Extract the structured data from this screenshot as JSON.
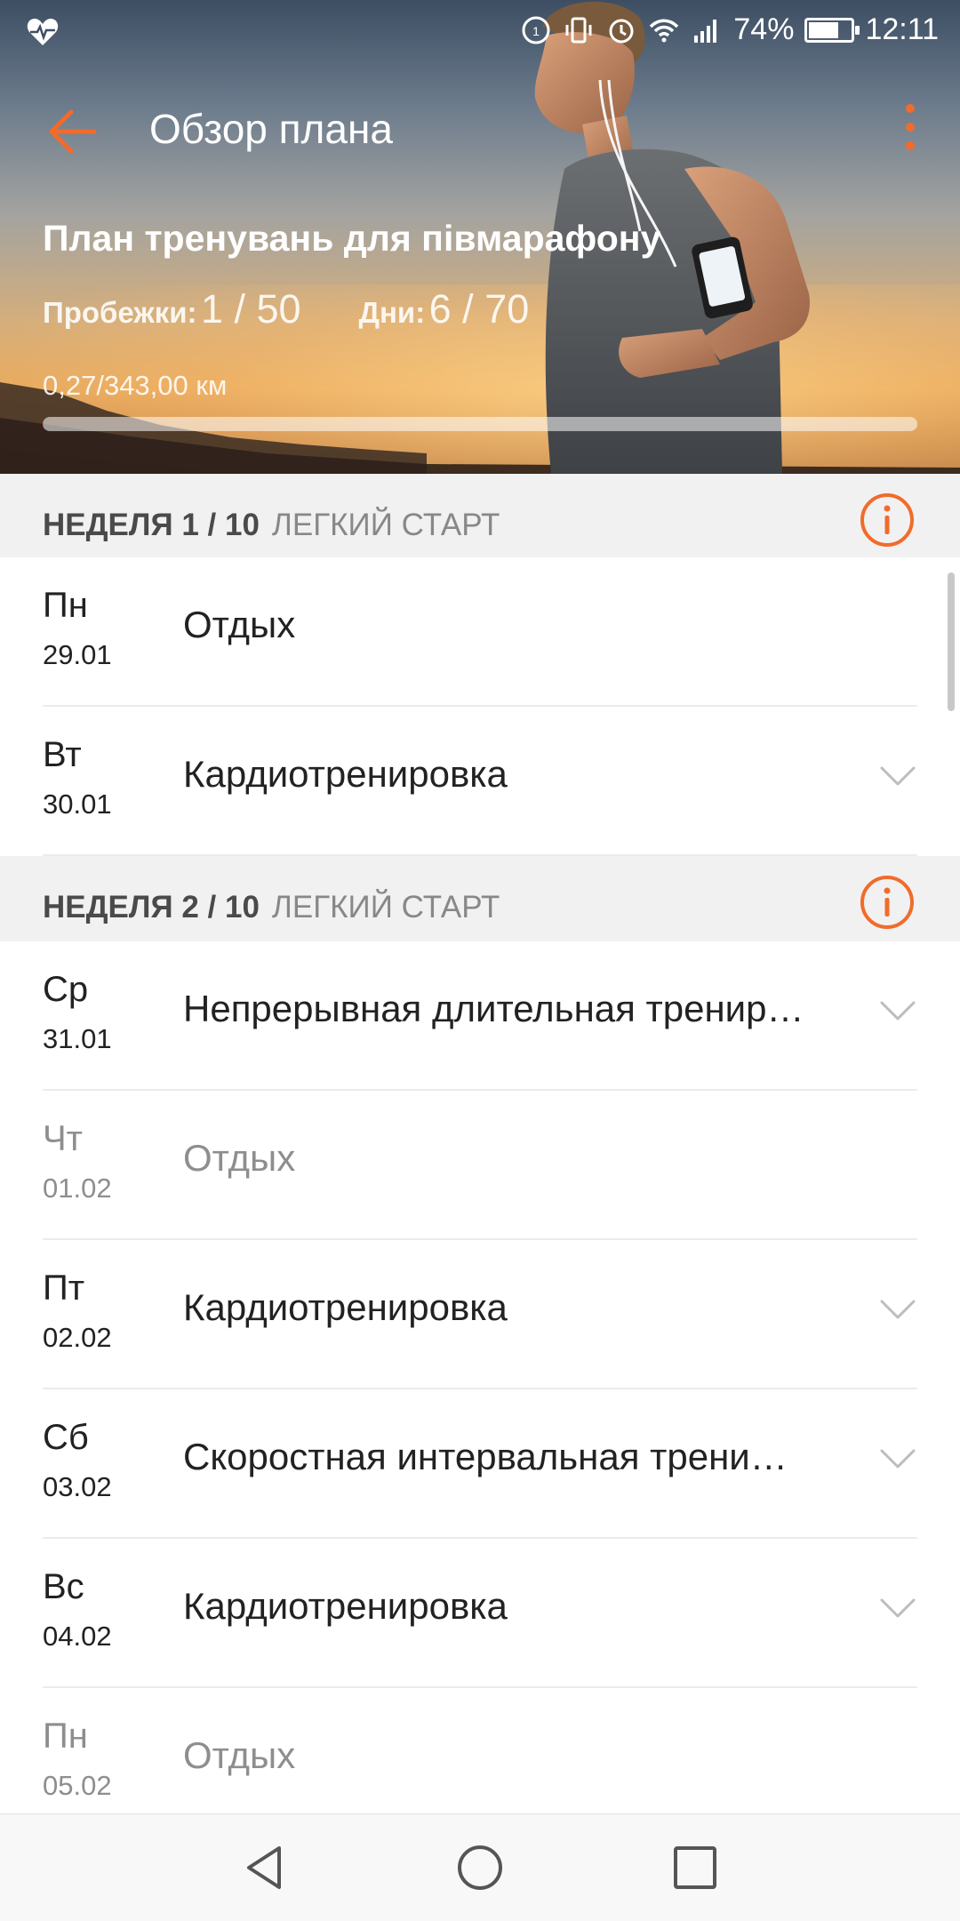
{
  "status_bar": {
    "battery_percent": "74%",
    "time": "12:11",
    "battery_level": 0.74
  },
  "header": {
    "title": "Обзор плана",
    "plan_name": "План тренувань для півмарафону",
    "runs_label": "Пробежки:",
    "runs_value": "1 / 50",
    "days_label": "Дни:",
    "days_value": "6 / 70",
    "distance": "0,27/343,00 км",
    "progress_fraction": 0.0008
  },
  "weeks": [
    {
      "label": "НЕДЕЛЯ 1 / 10",
      "subtitle": "ЛЕГКИЙ СТАРТ",
      "days": [
        {
          "day": "Пн",
          "date": "29.01",
          "title": "Отдых",
          "expandable": false,
          "muted": false
        },
        {
          "day": "Вт",
          "date": "30.01",
          "title": "Кардиотренировка",
          "expandable": true,
          "muted": false
        }
      ]
    },
    {
      "label": "НЕДЕЛЯ 2 / 10",
      "subtitle": "ЛЕГКИЙ СТАРТ",
      "days": [
        {
          "day": "Ср",
          "date": "31.01",
          "title": "Непрерывная длительная тренир…",
          "expandable": true,
          "muted": false
        },
        {
          "day": "Чт",
          "date": "01.02",
          "title": "Отдых",
          "expandable": false,
          "muted": true
        },
        {
          "day": "Пт",
          "date": "02.02",
          "title": "Кардиотренировка",
          "expandable": true,
          "muted": false
        },
        {
          "day": "Сб",
          "date": "03.02",
          "title": "Скоростная интервальная трени…",
          "expandable": true,
          "muted": false
        },
        {
          "day": "Вс",
          "date": "04.02",
          "title": "Кардиотренировка",
          "expandable": true,
          "muted": false
        },
        {
          "day": "Пн",
          "date": "05.02",
          "title": "Отдых",
          "expandable": false,
          "muted": true
        }
      ]
    }
  ],
  "colors": {
    "accent": "#f26b2b",
    "muted_text": "#8e8e8e",
    "section_bg": "#f1f1f1"
  }
}
